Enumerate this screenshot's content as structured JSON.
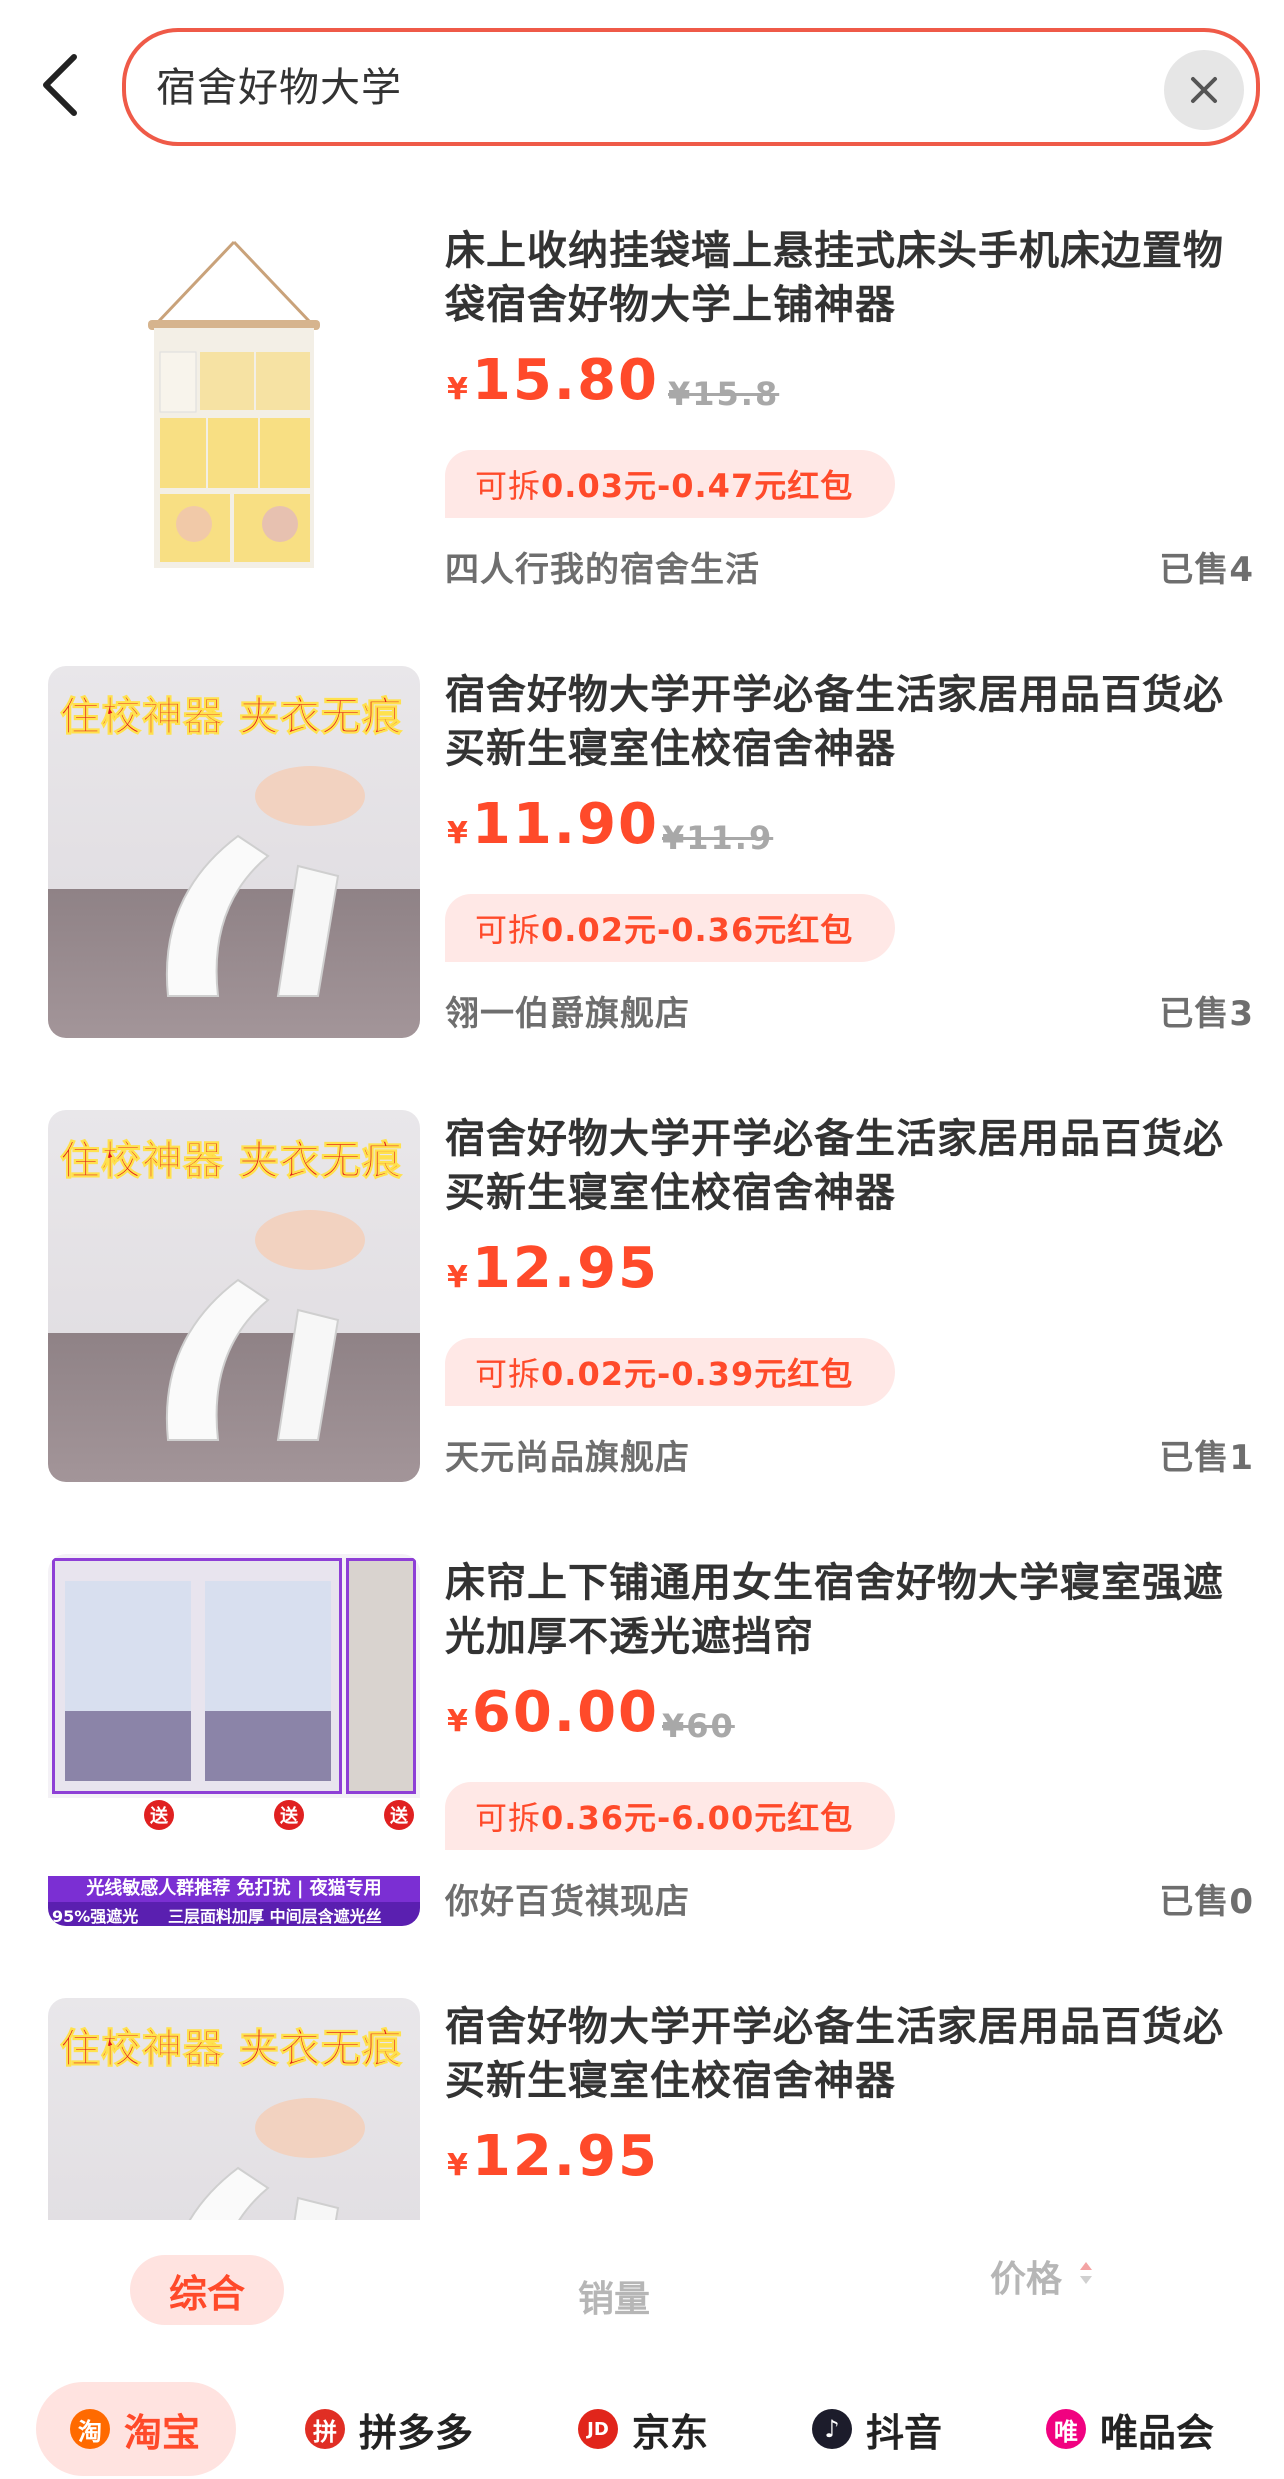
{
  "search": {
    "query": "宿舍好物大学"
  },
  "products": [
    {
      "title": "床上收纳挂袋墙上悬挂式床头手机床边置物袋宿舍好物大学上铺神器",
      "price_symbol": "¥",
      "price": "15.80",
      "original_price": "¥15.8",
      "coupon_prefix": "可拆",
      "coupon_value": "0.03元-0.47元红包",
      "shop": "四人行我的宿舍生活",
      "sold": "已售4"
    },
    {
      "title": "宿舍好物大学开学必备生活家居用品百货必买新生寝室住校宿舍神器",
      "image_text": "住校神器 夹衣无痕",
      "price_symbol": "¥",
      "price": "11.90",
      "original_price": "¥11.9",
      "coupon_prefix": "可拆",
      "coupon_value": "0.02元-0.36元红包",
      "shop": "翎一伯爵旗舰店",
      "sold": "已售3"
    },
    {
      "title": "宿舍好物大学开学必备生活家居用品百货必买新生寝室住校宿舍神器",
      "image_text": "住校神器 夹衣无痕",
      "price_symbol": "¥",
      "price": "12.95",
      "original_price": "",
      "coupon_prefix": "可拆",
      "coupon_value": "0.02元-0.39元红包",
      "shop": "天元尚品旗舰店",
      "sold": "已售1"
    },
    {
      "title": "床帘上下铺通用女生宿舍好物大学寝室强遮光加厚不透光遮挡帘",
      "image_banner": "光线敏感人群推荐 免打扰 | 夜猫专用",
      "image_tag1": "95%强遮光",
      "image_tag2": "三层面料加厚 中间层含遮光丝",
      "image_gift": "送",
      "price_symbol": "¥",
      "price": "60.00",
      "original_price": "¥60",
      "coupon_prefix": "可拆",
      "coupon_value": "0.36元-6.00元红包",
      "shop": "你好百货祺现店",
      "sold": "已售0"
    },
    {
      "title": "宿舍好物大学开学必备生活家居用品百货必买新生寝室住校宿舍神器",
      "image_text": "住校神器 夹衣无痕",
      "price_symbol": "¥",
      "price": "12.95"
    }
  ],
  "sort": {
    "comprehensive": "综合",
    "sales": "销量",
    "price": "价格"
  },
  "platforms": [
    {
      "label": "淘宝",
      "icon_char": "淘",
      "color": "#ff6a00"
    },
    {
      "label": "拼多多",
      "icon_char": "拼",
      "color": "#e02e24"
    },
    {
      "label": "京东",
      "icon_char": "JD",
      "color": "#e1251b"
    },
    {
      "label": "抖音",
      "icon_char": "♪",
      "color": "#1c1c2b"
    },
    {
      "label": "唯品会",
      "icon_char": "唯",
      "color": "#f10180"
    }
  ],
  "colors": {
    "accent": "#ff4a2a",
    "search_border": "#ef5a48",
    "coupon_bg": "#ffe8e6"
  }
}
